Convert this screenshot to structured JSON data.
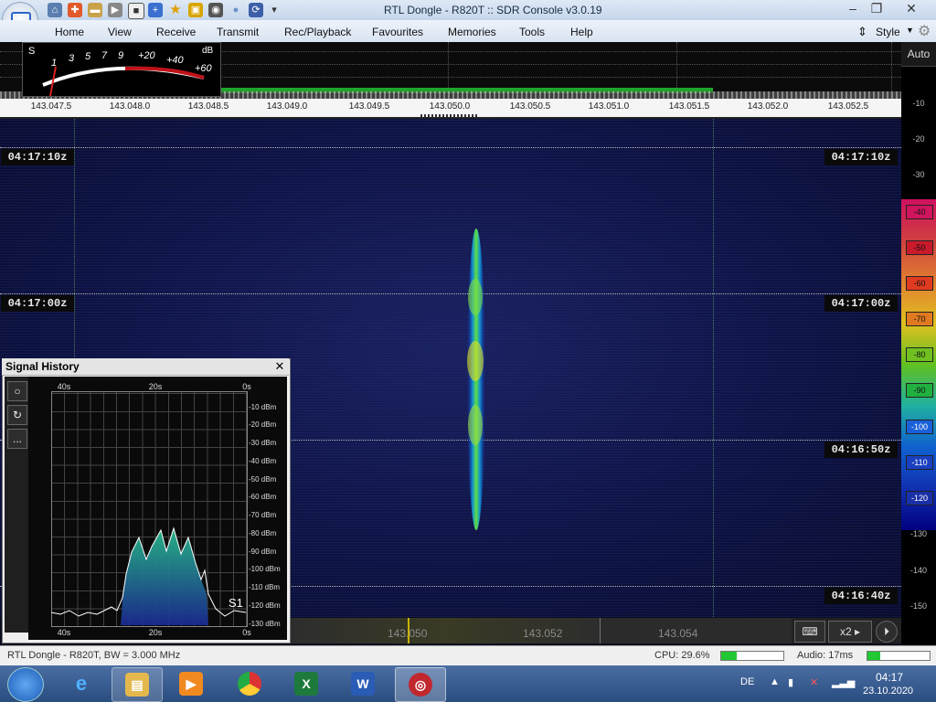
{
  "window": {
    "title": "RTL Dongle - R820T :: SDR Console v3.0.19",
    "controls": [
      "minimize",
      "maximize",
      "close"
    ]
  },
  "quick_access": [
    "home-icon",
    "lifebuoy-icon",
    "folder-icon",
    "play-icon",
    "stop-icon",
    "plus-icon",
    "star-icon",
    "lock-icon",
    "camera-icon",
    "drop-icon",
    "mouse-icon",
    "chevron-down-icon"
  ],
  "menu": {
    "items": [
      "Home",
      "View",
      "Receive",
      "Transmit",
      "Rec/Playback",
      "Favourites",
      "Memories",
      "Tools",
      "Help"
    ],
    "style_label": "Style"
  },
  "smeter": {
    "s_label": "S",
    "db_label": "dB",
    "s_scale": [
      "1",
      "3",
      "5",
      "7",
      "9"
    ],
    "plus_scale": [
      "+20",
      "+40",
      "+60"
    ]
  },
  "frequency_axis": [
    "143.047.5",
    "143.048.0",
    "143.048.5",
    "143.049.0",
    "143.049.5",
    "143.050.0",
    "143.050.5",
    "143.051.0",
    "143.051.5",
    "143.052.0",
    "143.052.5"
  ],
  "auto_button": "Auto",
  "db_scale_top": [
    "-10",
    "-20",
    "-30"
  ],
  "db_scale_color": [
    "-40",
    "-50",
    "-60",
    "-70",
    "-80",
    "-90",
    "-100",
    "-110",
    "-120"
  ],
  "db_scale_color_colors": [
    "#d0145e",
    "#c81a2a",
    "#e03a20",
    "#e07a20",
    "#70c020",
    "#20b040",
    "#1a60d8",
    "#1a40c0",
    "#1a30a8"
  ],
  "db_scale_bottom": [
    "-130",
    "-140",
    "-150"
  ],
  "timestamps": [
    "04:17:10z",
    "04:17:00z",
    "04:16:50z",
    "04:16:40z"
  ],
  "tuning": {
    "freqs": [
      "143.050",
      "143.052",
      "143.054"
    ],
    "zoom": "x2"
  },
  "signal_history": {
    "title": "Signal History",
    "x_top": [
      "40s",
      "20s",
      "0s"
    ],
    "x_bottom": [
      "40s",
      "20s",
      "0s"
    ],
    "y_ticks": [
      "-10 dBm",
      "-20 dBm",
      "-30 dBm",
      "-40 dBm",
      "-50 dBm",
      "-60 dBm",
      "-70 dBm",
      "-80 dBm",
      "-90 dBm",
      "-100 dBm",
      "-110 dBm",
      "-120 dBm",
      "-130 dBm"
    ],
    "s_reading": "S1",
    "buttons": [
      "○",
      "↻",
      "..."
    ]
  },
  "status": {
    "device": "RTL Dongle - R820T, BW = 3.000 MHz",
    "cpu": "CPU: 29.6%",
    "cpu_level": 0.25,
    "audio": "Audio: 17ms",
    "audio_level": 0.2
  },
  "taskbar": {
    "apps": [
      "internet-explorer",
      "file-explorer",
      "media-player",
      "chrome",
      "excel",
      "word",
      "sdr-console"
    ],
    "lang": "DE",
    "time": "04:17",
    "date": "23.10.2020"
  }
}
